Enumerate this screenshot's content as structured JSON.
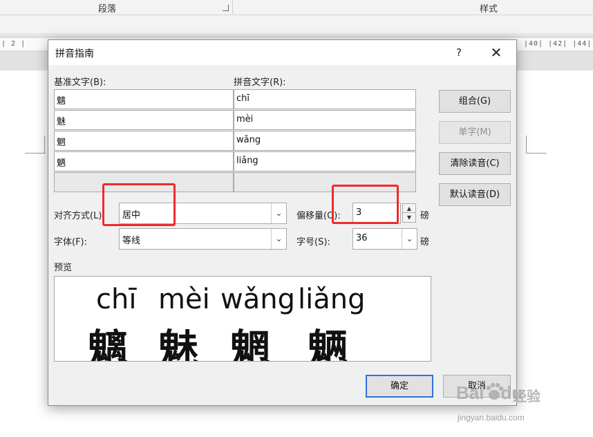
{
  "background": {
    "ribbon_groups": [
      "段落",
      "样式"
    ],
    "ruler_left": "| 2 |",
    "ruler_right": "|40| |42| |44|"
  },
  "dialog": {
    "title": "拼音指南",
    "help": "?",
    "close": "✕",
    "base_text_label": "基准文字(B):",
    "ruby_text_label": "拼音文字(R):",
    "rows": [
      {
        "base": "魑",
        "ruby": "chī"
      },
      {
        "base": "魅",
        "ruby": "mèi"
      },
      {
        "base": "魍",
        "ruby": "wǎng"
      },
      {
        "base": "魉",
        "ruby": "liǎng"
      },
      {
        "base": "",
        "ruby": ""
      }
    ],
    "buttons": {
      "group": "组合(G)",
      "mono": "单字(M)",
      "clear": "清除读音(C)",
      "default": "默认读音(D)",
      "ok": "确定",
      "cancel": "取消"
    },
    "alignment": {
      "label": "对齐方式(L):",
      "value": "居中"
    },
    "offset": {
      "label": "偏移量(O):",
      "value": "3",
      "unit": "磅"
    },
    "font": {
      "label": "字体(F):",
      "value": "等线"
    },
    "size": {
      "label": "字号(S):",
      "value": "36",
      "unit": "磅"
    },
    "preview": {
      "label": "预览",
      "pinyin": [
        "chī",
        "mèi",
        "wǎng",
        "liǎng"
      ],
      "hanzi": [
        "魑",
        "魅",
        "魍",
        "魉"
      ]
    }
  },
  "watermark": {
    "main": "Bai",
    "brand2": "du",
    "jy": "经验",
    "sub": "jingyan.baidu.com"
  },
  "colors": {
    "highlight": "#ef2b2b",
    "primary_border": "#2a72d9"
  }
}
